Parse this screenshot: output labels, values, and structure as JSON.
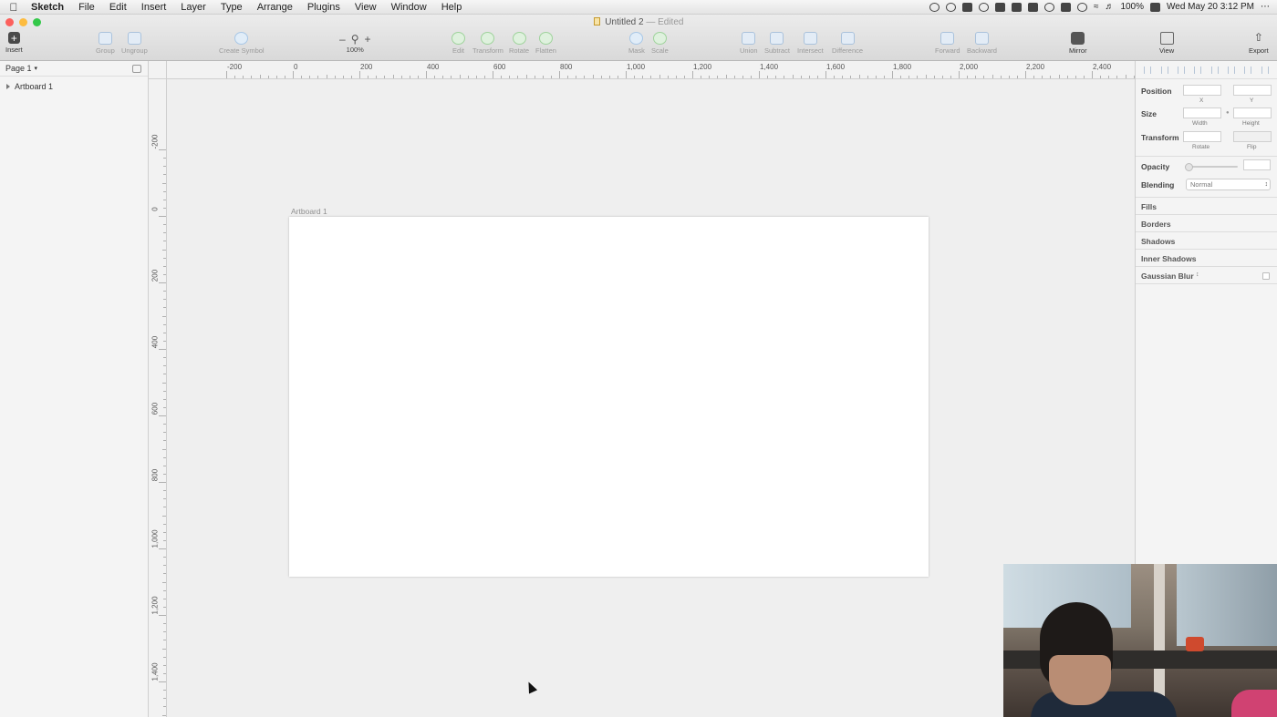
{
  "menubar": {
    "app": "Sketch",
    "items": [
      "File",
      "Edit",
      "Insert",
      "Layer",
      "Type",
      "Arrange",
      "Plugins",
      "View",
      "Window",
      "Help"
    ],
    "battery": "100%",
    "datetime": "Wed May 20  3:12 PM"
  },
  "window": {
    "title": "Untitled 2",
    "status": "— Edited"
  },
  "toolbar": {
    "insert": "Insert",
    "group": "Group",
    "ungroup": "Ungroup",
    "create_symbol": "Create Symbol",
    "zoom_minus": "–",
    "zoom_plus": "+",
    "zoom_level": "100%",
    "edit": "Edit",
    "transform": "Transform",
    "rotate": "Rotate",
    "flatten": "Flatten",
    "mask": "Mask",
    "scale": "Scale",
    "union": "Union",
    "subtract": "Subtract",
    "intersect": "Intersect",
    "difference": "Difference",
    "forward": "Forward",
    "backward": "Backward",
    "mirror": "Mirror",
    "view": "View",
    "export": "Export"
  },
  "layers": {
    "page": "Page 1",
    "items": [
      "Artboard 1"
    ]
  },
  "rulers": {
    "horizontal": [
      "-200",
      "0",
      "200",
      "400",
      "600",
      "800",
      "1,000",
      "1,200",
      "1,400",
      "1,600",
      "1,800",
      "2,000",
      "2,200",
      "2,400"
    ],
    "vertical": [
      "-200",
      "0",
      "200",
      "400",
      "600",
      "800",
      "1,000",
      "1,200",
      "1,400"
    ]
  },
  "canvas": {
    "artboard_label": "Artboard 1"
  },
  "inspector": {
    "position": "Position",
    "x": "X",
    "y": "Y",
    "size": "Size",
    "width": "Width",
    "height": "Height",
    "transform": "Transform",
    "rotate": "Rotate",
    "flip": "Flip",
    "opacity": "Opacity",
    "blending": "Blending",
    "blending_value": "Normal",
    "fills": "Fills",
    "borders": "Borders",
    "shadows": "Shadows",
    "inner_shadows": "Inner Shadows",
    "gaussian_blur": "Gaussian Blur"
  },
  "colors": {
    "traffic_close": "#fc605c",
    "traffic_min": "#fdbc40",
    "traffic_max": "#34c84a"
  }
}
